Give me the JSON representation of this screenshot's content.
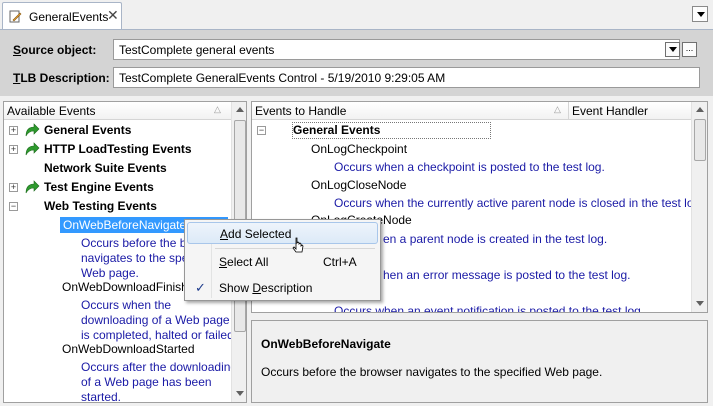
{
  "tab": {
    "title": "GeneralEvents",
    "close_glyph": "✕",
    "icon": "document-edit-icon"
  },
  "header": {
    "source_label_prefix": "S",
    "source_label_rest": "ource object:",
    "source_value": "TestComplete general events",
    "tlb_label_prefix": "T",
    "tlb_label_rest": "LB Description:",
    "tlb_value": "TestComplete GeneralEvents Control - 5/19/2010 9:29:05 AM",
    "ellipsis": "..."
  },
  "left": {
    "header": "Available Events",
    "groups": [
      {
        "expander": "+",
        "label": "General Events"
      },
      {
        "expander": "+",
        "label": "HTTP LoadTesting Events"
      },
      {
        "expander": "",
        "label": "Network Suite Events"
      },
      {
        "expander": "+",
        "label": "Test Engine Events"
      },
      {
        "expander": "−",
        "label": "Web Testing Events"
      }
    ],
    "events": [
      {
        "name": "OnWebBeforeNavigate",
        "desc": [
          "Occurs before the bro",
          "navigates to the spec",
          "Web page."
        ]
      },
      {
        "name": "OnWebDownloadFinished",
        "desc": [
          "Occurs when the",
          "downloading of a Web page",
          "is completed, halted or failed."
        ]
      },
      {
        "name": "OnWebDownloadStarted",
        "desc": [
          "Occurs after the downloading",
          "of a Web page has been",
          "started."
        ]
      }
    ]
  },
  "right": {
    "col_events": "Events to Handle",
    "col_handler": "Event Handler",
    "group": "General Events",
    "expander": "−",
    "events": [
      {
        "name": "OnLogCheckpoint",
        "desc": "Occurs when a checkpoint is posted to the test log."
      },
      {
        "name": "OnLogCloseNode",
        "desc": "Occurs when the currently active parent node is closed in the test log."
      },
      {
        "name": "OnLogCreateNode",
        "desc": "en a parent node is created in the test log."
      },
      {
        "name": "",
        "desc": "hen an error message is posted to the test log."
      },
      {
        "name": "",
        "desc": "Occurs when an event notification is posted to the test log."
      }
    ]
  },
  "info": {
    "title": "OnWebBeforeNavigate",
    "text": "Occurs before the browser navigates to the specified Web page."
  },
  "menu": {
    "add_prefix": "A",
    "add_rest": "dd Selected",
    "select_prefix": "S",
    "select_rest": "elect All",
    "select_shortcut": "Ctrl+A",
    "show_pre": "Show ",
    "show_u": "D",
    "show_rest": "escription",
    "check": "✓"
  },
  "colors": {
    "accent": "#3399ff",
    "desc_text": "#1a1aa6",
    "header_bg": "#d4d4d4"
  }
}
